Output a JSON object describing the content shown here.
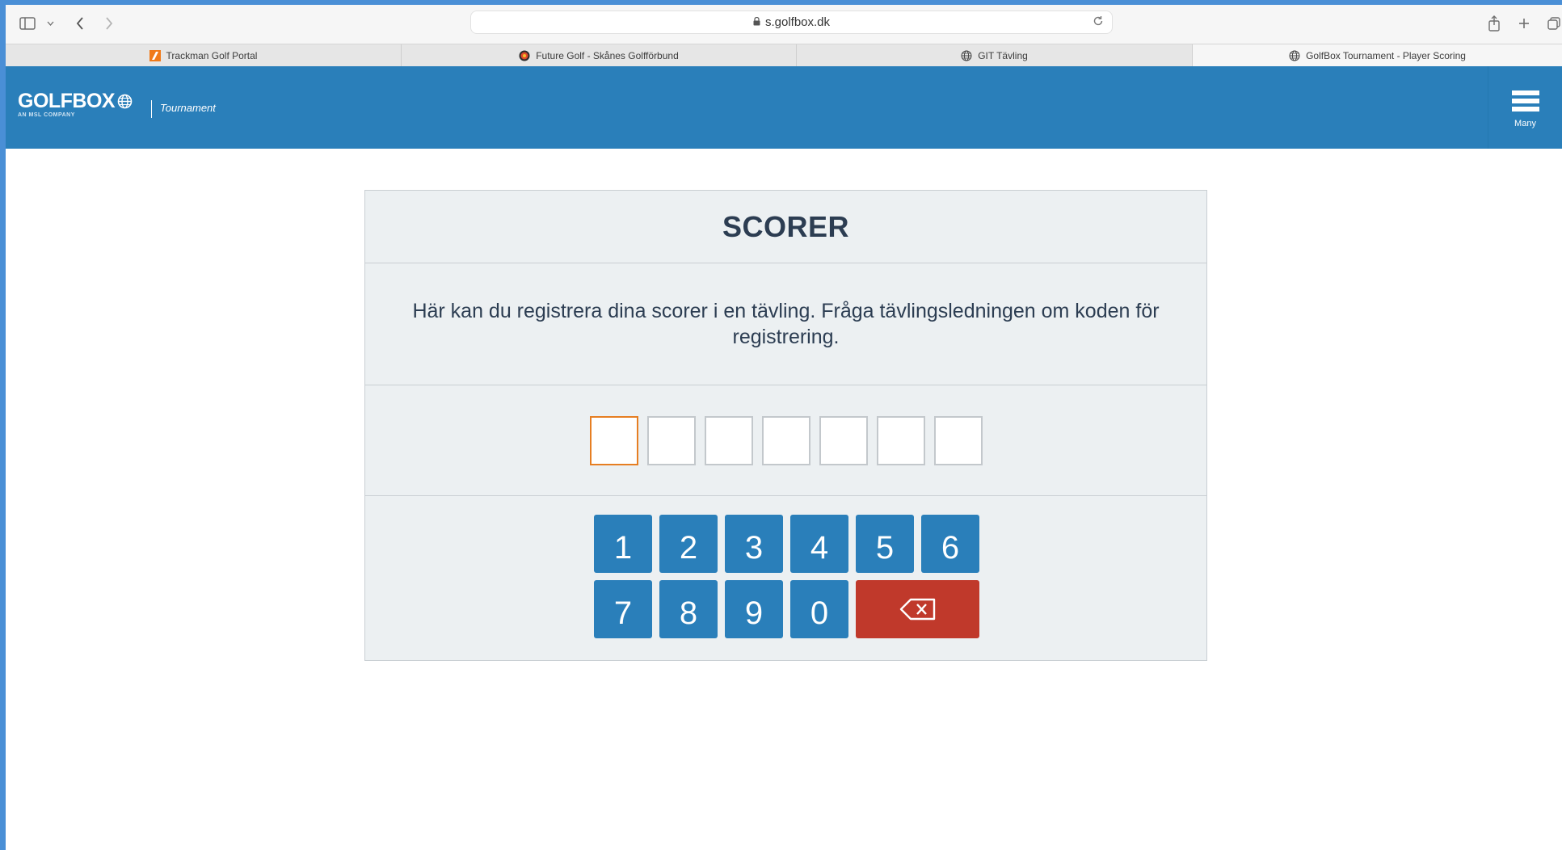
{
  "browser": {
    "url": "s.golfbox.dk",
    "tabs": [
      {
        "label": "Trackman Golf Portal",
        "icon": "trackman-icon"
      },
      {
        "label": "Future Golf - Skånes Golfförbund",
        "icon": "skane-golf-icon"
      },
      {
        "label": "GIT Tävling",
        "icon": "globe-icon"
      },
      {
        "label": "GolfBox Tournament - Player Scoring",
        "icon": "globe-icon",
        "active": true
      }
    ]
  },
  "header": {
    "logo": "GOLFBOX",
    "logo_sub": "AN MSL COMPANY",
    "product": "Tournament",
    "menu_label": "Many"
  },
  "card": {
    "title": "SCORER",
    "description": "Här kan du registrera dina scorer i en tävling. Fråga tävlingsledningen om koden för registrering.",
    "code_length": 7,
    "keys_row1": [
      "1",
      "2",
      "3",
      "4",
      "5",
      "6"
    ],
    "keys_row2": [
      "7",
      "8",
      "9",
      "0"
    ],
    "backspace_icon": "backspace-icon"
  },
  "colors": {
    "brand_blue": "#2a7fba",
    "danger_red": "#c0392b",
    "active_input_border": "#e67e22",
    "text_dark": "#2c3d52"
  }
}
